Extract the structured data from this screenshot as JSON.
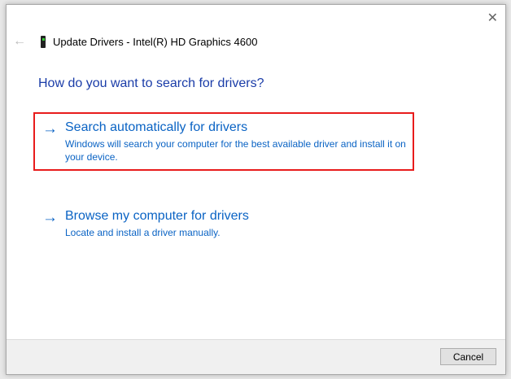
{
  "window": {
    "title": "Update Drivers - Intel(R) HD Graphics 4600"
  },
  "heading": "How do you want to search for drivers?",
  "options": [
    {
      "label": "Search automatically for drivers",
      "description": "Windows will search your computer for the best available driver and install it on your device.",
      "highlighted": true
    },
    {
      "label": "Browse my computer for drivers",
      "description": "Locate and install a driver manually.",
      "highlighted": false
    }
  ],
  "footer": {
    "cancel_label": "Cancel"
  },
  "icons": {
    "arrow": "→",
    "back": "←",
    "close": "✕"
  },
  "colors": {
    "link": "#0a63c4",
    "heading": "#1a3ca8",
    "highlight": "#e81c1c"
  }
}
